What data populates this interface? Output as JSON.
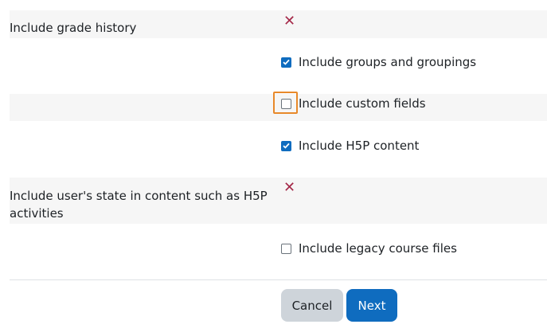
{
  "settings": {
    "grade_history": {
      "label": "Include grade history",
      "status_icon": "x-icon",
      "status": "✕"
    },
    "user_state": {
      "label": "Include user's state in content such as H5P activities",
      "status_icon": "x-icon",
      "status": "✕"
    }
  },
  "options": [
    {
      "label": "Include groups and groupings",
      "checked": true
    },
    {
      "label": "Include custom fields",
      "checked": false,
      "focused": true
    },
    {
      "label": "Include H5P content",
      "checked": true
    },
    {
      "label": "Include legacy course files",
      "checked": false
    }
  ],
  "buttons": {
    "cancel_label": "Cancel",
    "next_label": "Next"
  },
  "colors": {
    "accent": "#0f6cbf",
    "x_mark": "#a52a4a",
    "focus": "#e8892a",
    "band": "#f6f6f6"
  }
}
